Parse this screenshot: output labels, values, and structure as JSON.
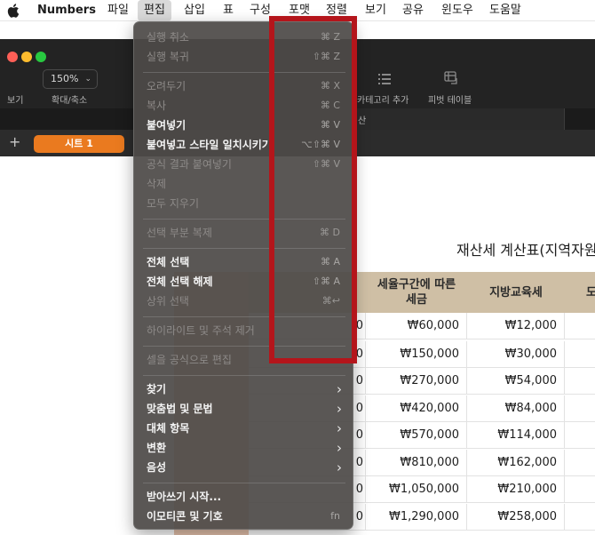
{
  "menubar": {
    "app_name": "Numbers",
    "items": [
      "파일",
      "편집",
      "삽입",
      "표",
      "구성",
      "포맷",
      "정렬",
      "보기",
      "공유",
      "윈도우",
      "도움말"
    ]
  },
  "toolbar": {
    "view_label": "보기",
    "zoom_value": "150%",
    "zoom_label": "확대/축소",
    "category_label": "카테고리 추가",
    "pivot_label": "피벗 테이블",
    "doc_tab_fragment": "산"
  },
  "sheets": {
    "add_label": "+",
    "active_sheet": "시트 1"
  },
  "table": {
    "title": "재산세 계산표(지역자원",
    "headers": [
      "세율구간에 따른\n세금",
      "지방교육세",
      "도"
    ],
    "partial_digit": "0",
    "tax_by_bracket": [
      "₩60,000",
      "₩150,000",
      "₩270,000",
      "₩420,000",
      "₩570,000",
      "₩810,000",
      "₩1,050,000",
      "₩1,290,000"
    ],
    "local_education_tax": [
      "₩12,000",
      "₩30,000",
      "₩54,000",
      "₩84,000",
      "₩114,000",
      "₩162,000",
      "₩210,000",
      "₩258,000"
    ]
  },
  "edit_menu": {
    "items": [
      {
        "label": "실행 취소",
        "shortcut": "⌘ Z",
        "enabled": false
      },
      {
        "label": "실행 복귀",
        "shortcut": "⇧⌘ Z",
        "enabled": false
      },
      {
        "label": "오려두기",
        "shortcut": "⌘ X",
        "enabled": false
      },
      {
        "label": "복사",
        "shortcut": "⌘ C",
        "enabled": false
      },
      {
        "label": "붙여넣기",
        "shortcut": "⌘ V",
        "enabled": true
      },
      {
        "label": "붙여넣고 스타일 일치시키기",
        "shortcut": "⌥⇧⌘ V",
        "enabled": true
      },
      {
        "label": "공식 결과 붙여넣기",
        "shortcut": "⇧⌘ V",
        "enabled": false
      },
      {
        "label": "삭제",
        "shortcut": "",
        "enabled": false
      },
      {
        "label": "모두 지우기",
        "shortcut": "",
        "enabled": false
      },
      {
        "label": "선택 부분 복제",
        "shortcut": "⌘ D",
        "enabled": false
      },
      {
        "label": "전체 선택",
        "shortcut": "⌘ A",
        "enabled": true
      },
      {
        "label": "전체 선택 해제",
        "shortcut": "⇧⌘ A",
        "enabled": true
      },
      {
        "label": "상위 선택",
        "shortcut": "⌘↩",
        "enabled": false
      },
      {
        "label": "하이라이트 및 주석 제거",
        "shortcut": "",
        "enabled": false
      },
      {
        "label": "셀을 공식으로 편집",
        "shortcut": "",
        "enabled": false
      },
      {
        "label": "찾기",
        "submenu": true,
        "enabled": true
      },
      {
        "label": "맞춤법 및 문법",
        "submenu": true,
        "enabled": true
      },
      {
        "label": "대체 항목",
        "submenu": true,
        "enabled": true
      },
      {
        "label": "변환",
        "submenu": true,
        "enabled": true
      },
      {
        "label": "음성",
        "submenu": true,
        "enabled": true
      },
      {
        "label": "받아쓰기 시작...",
        "shortcut": "",
        "enabled": true
      },
      {
        "label": "이모티콘 및 기호",
        "shortcut": "fn",
        "enabled": true
      }
    ]
  },
  "colors": {
    "highlight_box": "#b4151b",
    "sheet_tab": "#ea7a1f",
    "table_header": "#cfbfa5"
  }
}
